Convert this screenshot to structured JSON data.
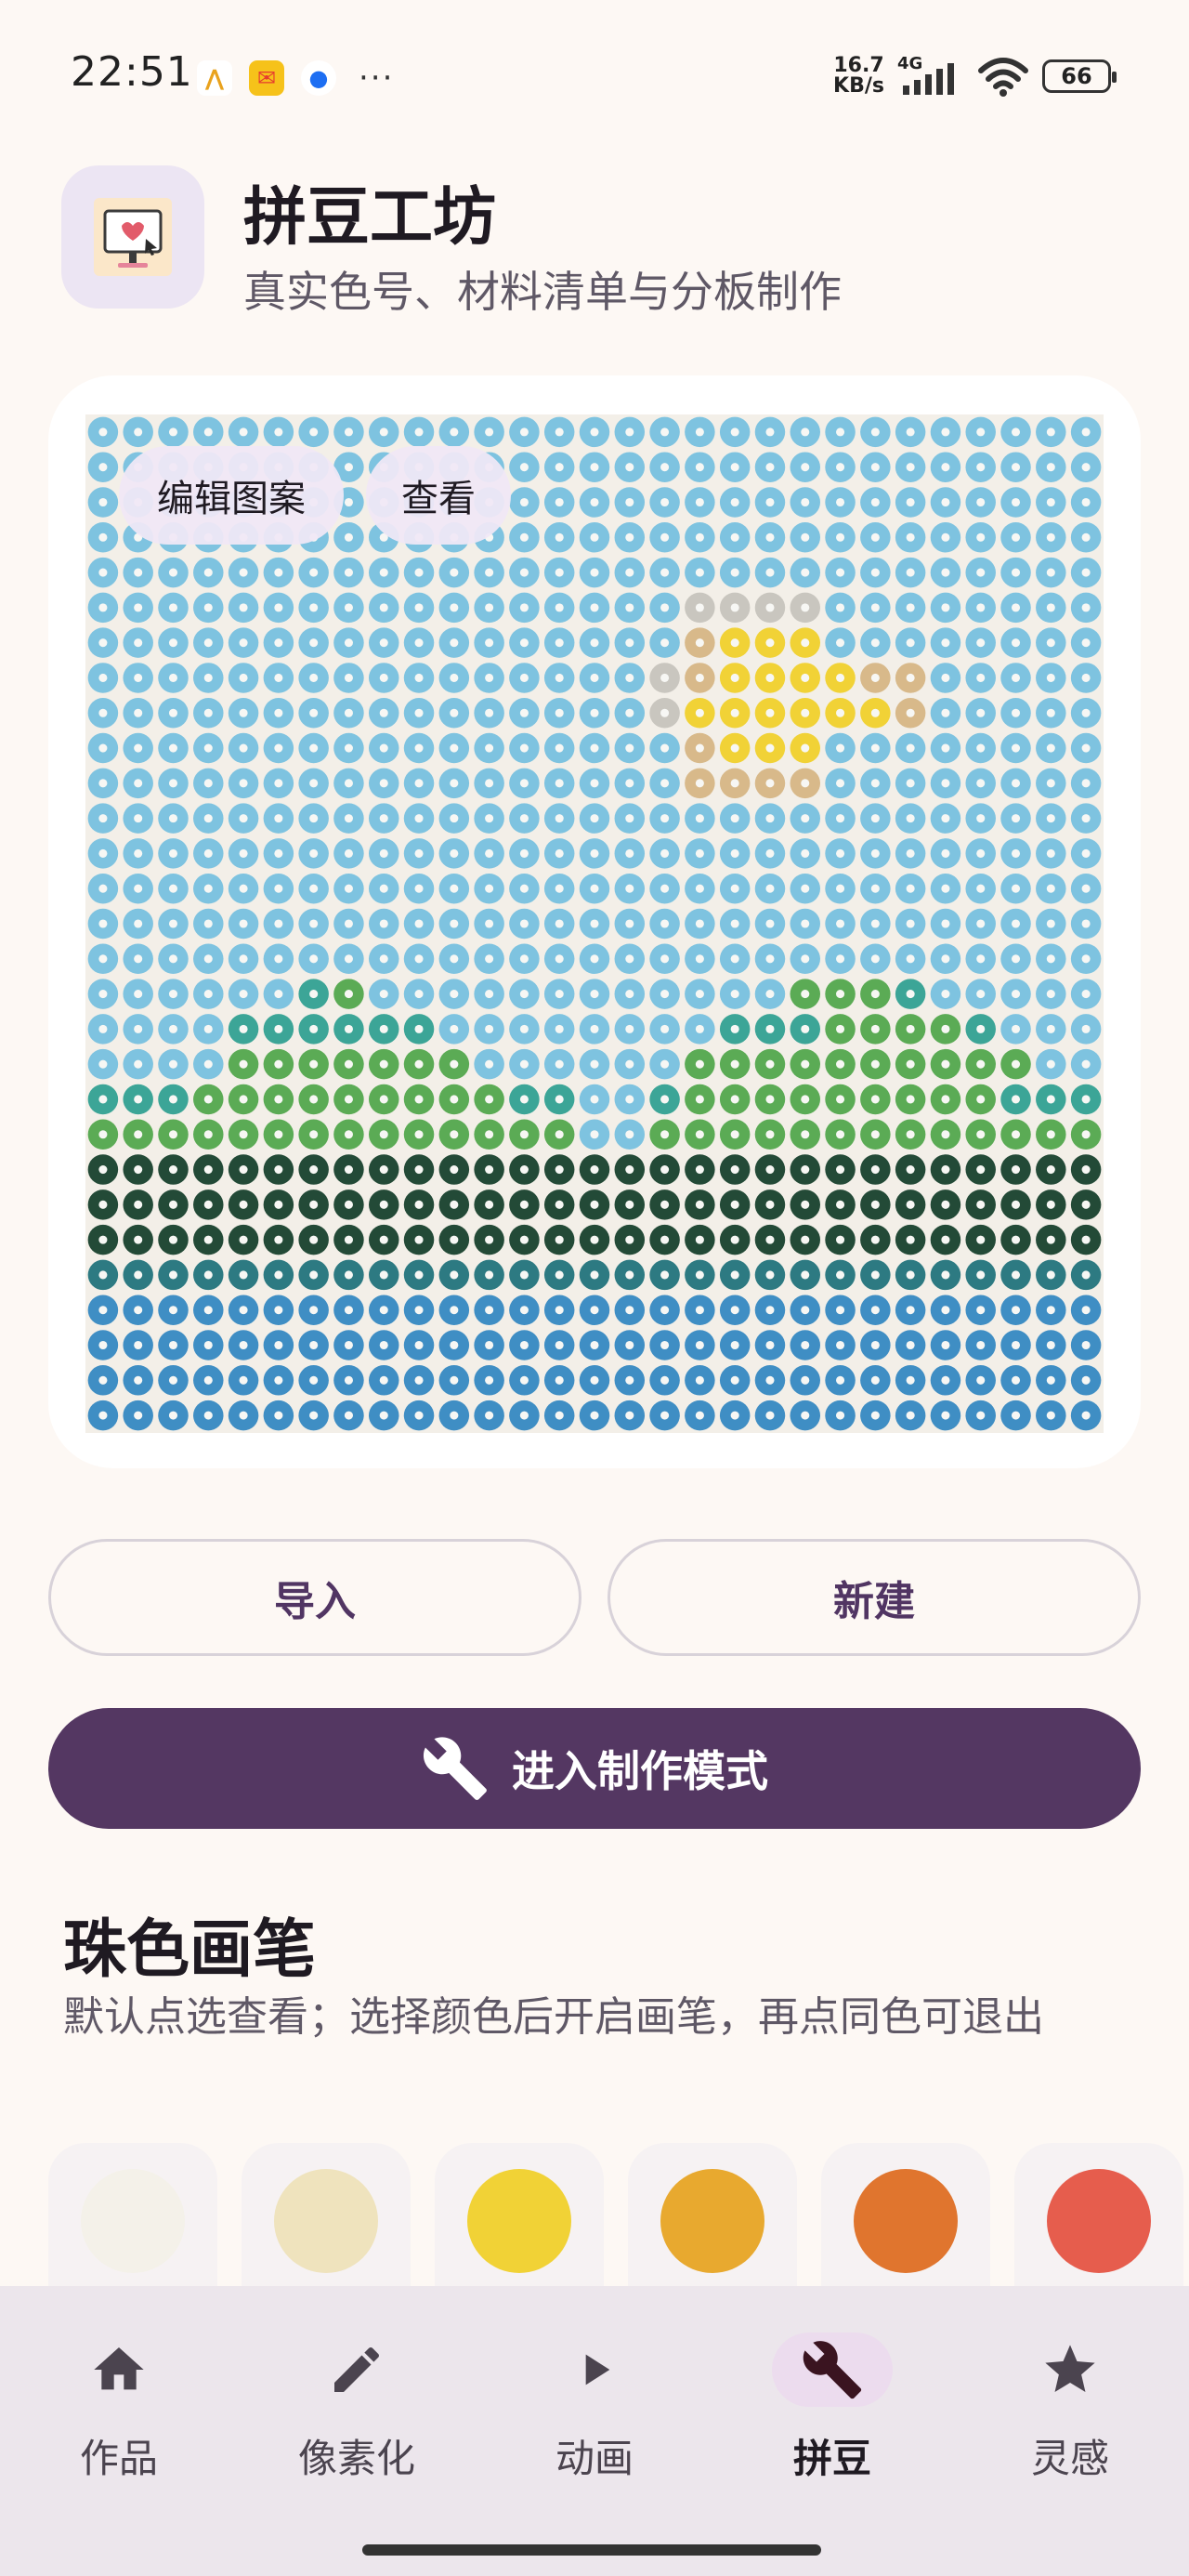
{
  "status_bar": {
    "time": "22:51",
    "notifications": [
      "ks-icon",
      "mail-icon",
      "p-icon"
    ],
    "net_speed_top": "16.7",
    "net_speed_bottom": "KB/s",
    "network": "4G",
    "battery": "66"
  },
  "header": {
    "title": "拼豆工坊",
    "subtitle": "真实色号、材料清单与分板制作"
  },
  "canvas": {
    "edit_label": "编辑图案",
    "view_label": "查看",
    "grid_columns": 29,
    "grid_rows": 29,
    "palette": {
      "S": "#7ec3e0",
      "G": "#c9c6bf",
      "T": "#d8b98a",
      "Y": "#f1d236",
      "E": "#3ca597",
      "L": "#5bab55",
      "D": "#234a37",
      "F": "#2d7a82",
      "W": "#3f8ec4"
    },
    "rows": [
      "SSSSSSSSSSSSSSSSSSSSSSSSSSSSS",
      "SSSSSSSSSSSSSSSSSSSSSSSSSSSSS",
      "SSSSSSSSSSSSSSSSSSSSSSSSSSSSS",
      "SSSSSSSSSSSSSSSSSSSSSSSSSSSSS",
      "SSSSSSSSSSSSSSSSSSSSSSSSSSSSS",
      "SSSSSSSSSSSSSSSSSGGGGSSSSSSSS",
      "SSSSSSSSSSSSSSSSSTYYYSSSSSSSS",
      "SSSSSSSSSSSSSSSSGTYYYYTTSSSSS",
      "SSSSSSSSSSSSSSSSGYYYYYYTSSSSS",
      "SSSSSSSSSSSSSSSSSTYYYSSSSSSSS",
      "SSSSSSSSSSSSSSSSSTTTTSSSSSSSS",
      "SSSSSSSSSSSSSSSSSSSSSSSSSSSSS",
      "SSSSSSSSSSSSSSSSSSSSSSSSSSSSS",
      "SSSSSSSSSSSSSSSSSSSSSSSSSSSSS",
      "SSSSSSSSSSSSSSSSSSSSSSSSSSSSS",
      "SSSSSSSSSSSSSSSSSSSSSSSSSSSSS",
      "SSSSSSELSSSSSSSSSSSSLLLESSSSS",
      "SSSSEEEEEESSSSSSSSEEELLLLESSS",
      "SSSSLLLLLLLSSSSSSLLLLLLLLLLSS",
      "EEELLLLLLLLLEESSELLLLLLLLLEEE",
      "LLLLLLLLLLLLLLSSLLLLLLLLLLLLL",
      "DDDDDDDDDDDDDDDDDDDDDDDDDDDDD",
      "DDDDDDDDDDDDDDDDDDDDDDDDDDDDD",
      "DDDDDDDDDDDDDDDDDDDDDDDDDDDDD",
      "FFFFFFFFFFFFFFFFFFFFFFFFFFFFF",
      "WWWWWWWWWWWWWWWWWWWWWWWWWWWWW",
      "WWWWWWWWWWWWWWWWWWWWWWWWWWWWW",
      "WWWWWWWWWWWWWWWWWWWWWWWWWWWWW",
      "WWWWWWWWWWWWWWWWWWWWWWWWWWWWW"
    ]
  },
  "actions": {
    "import_label": "导入",
    "create_label": "新建",
    "make_mode_label": "进入制作模式"
  },
  "palette_section": {
    "title": "珠色画笔",
    "description": "默认点选查看；选择颜色后开启画笔，再点同色可退出",
    "swatches": [
      "#f4f1e9",
      "#efe3bd",
      "#f1d236",
      "#e8a92f",
      "#e0752e",
      "#e65d4d"
    ]
  },
  "bottom_nav": {
    "items": [
      {
        "label": "作品",
        "icon": "home-icon"
      },
      {
        "label": "像素化",
        "icon": "pencil-icon"
      },
      {
        "label": "动画",
        "icon": "play-icon"
      },
      {
        "label": "拼豆",
        "icon": "wrench-icon",
        "active": true
      },
      {
        "label": "灵感",
        "icon": "star-icon"
      }
    ]
  }
}
